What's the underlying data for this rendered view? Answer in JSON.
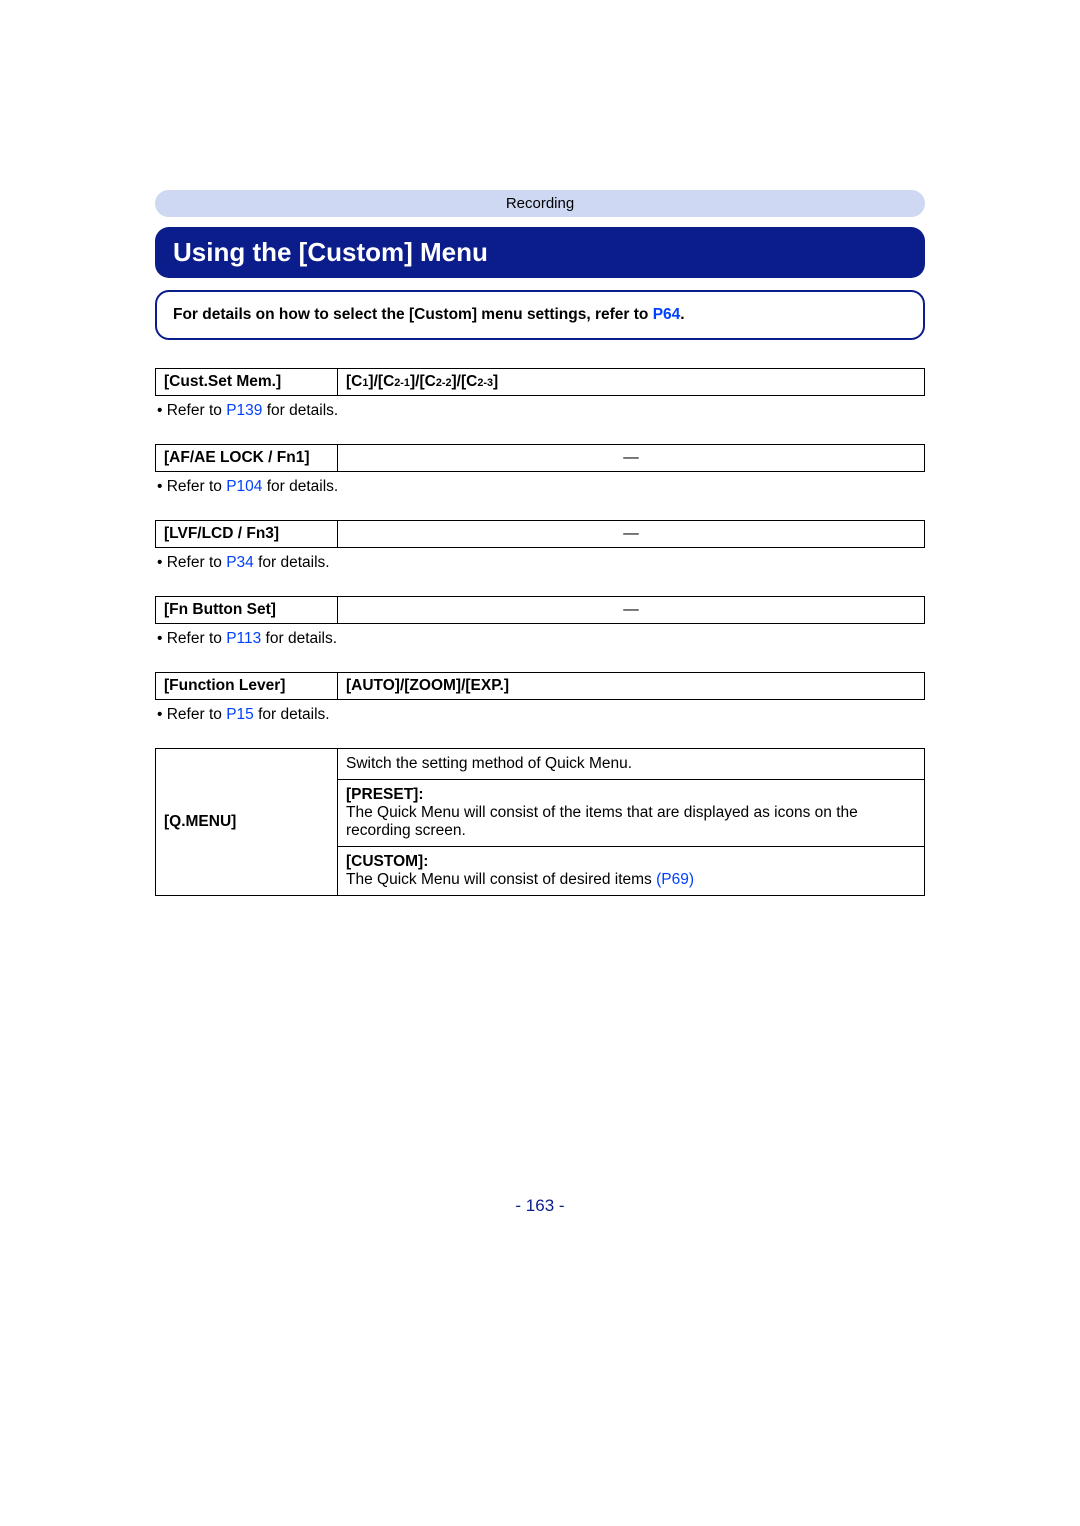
{
  "header": {
    "section": "Recording"
  },
  "title": "Using the [Custom] Menu",
  "note": {
    "prefix": "For details on how to select the [Custom] menu settings, refer to ",
    "link": "P64",
    "suffix": "."
  },
  "rows": [
    {
      "label": "[Cust.Set Mem.]",
      "value_html": true,
      "c1": "C",
      "c1s": "1",
      "c2": "C",
      "c2s": "2-1",
      "c3": "C",
      "c3s": "2-2",
      "c4": "C",
      "c4s": "2-3",
      "refer_prefix": "• Refer to ",
      "refer_link": "P139",
      "refer_suffix": " for details."
    },
    {
      "label": "[AF/AE LOCK / Fn1]",
      "value": "—",
      "dash": true,
      "refer_prefix": "• Refer to ",
      "refer_link": "P104",
      "refer_suffix": " for details."
    },
    {
      "label": "[LVF/LCD / Fn3]",
      "value": "—",
      "dash": true,
      "refer_prefix": "• Refer to ",
      "refer_link": "P34",
      "refer_suffix": " for details."
    },
    {
      "label": "[Fn Button Set]",
      "value": "—",
      "dash": true,
      "refer_prefix": "• Refer to ",
      "refer_link": "P113",
      "refer_suffix": " for details."
    },
    {
      "label": "[Function Lever]",
      "value": "[AUTO]/[ZOOM]/[EXP.]",
      "bold_value": true,
      "refer_prefix": "• Refer to ",
      "refer_link": "P15",
      "refer_suffix": " for details."
    }
  ],
  "qmenu": {
    "label": "[Q.MENU]",
    "r1": "Switch the setting method of Quick Menu.",
    "r2title": "[PRESET]:",
    "r2text": "The Quick Menu will consist of the items that are displayed as icons on the recording screen.",
    "r3title": "[CUSTOM]:",
    "r3text_prefix": "The Quick Menu will consist of desired items ",
    "r3link": "(P69)"
  },
  "pagenum": "- 163 -"
}
